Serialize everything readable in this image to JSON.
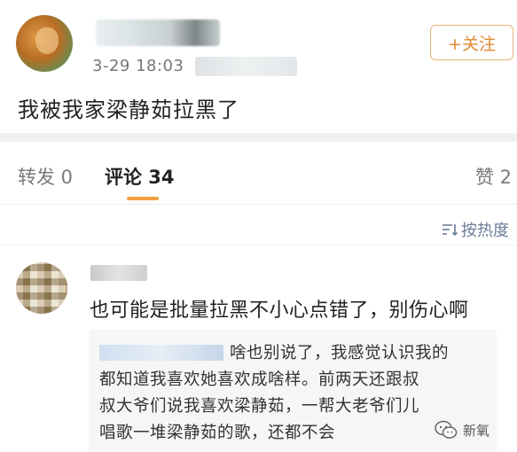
{
  "post": {
    "time": "3-29 18:03",
    "follow_label": "+关注",
    "text": "我被我家梁静茹拉黑了"
  },
  "tabs": {
    "repost": "转发 0",
    "comment": "评论 34",
    "like": "赞 2"
  },
  "sort": {
    "label": "按热度",
    "icon": "sort-icon"
  },
  "comment": {
    "text": "也可能是批量拉黑不小心点错了，别伤心啊",
    "reply": {
      "line1": "啥也别说了，我感觉认识我的",
      "line2": "都知道我喜欢她喜欢成啥样。前两天还跟叔",
      "line3": "叔大爷们说我喜欢梁静茹，一帮大老爷们儿",
      "line4": "唱歌一堆梁静茹的歌，还都不会"
    }
  },
  "watermark": {
    "label": "新氧",
    "icon": "wechat-icon"
  },
  "colors": {
    "accent": "#e28830",
    "tab_underline": "#f0a040",
    "sort_text": "#6a7d99"
  }
}
